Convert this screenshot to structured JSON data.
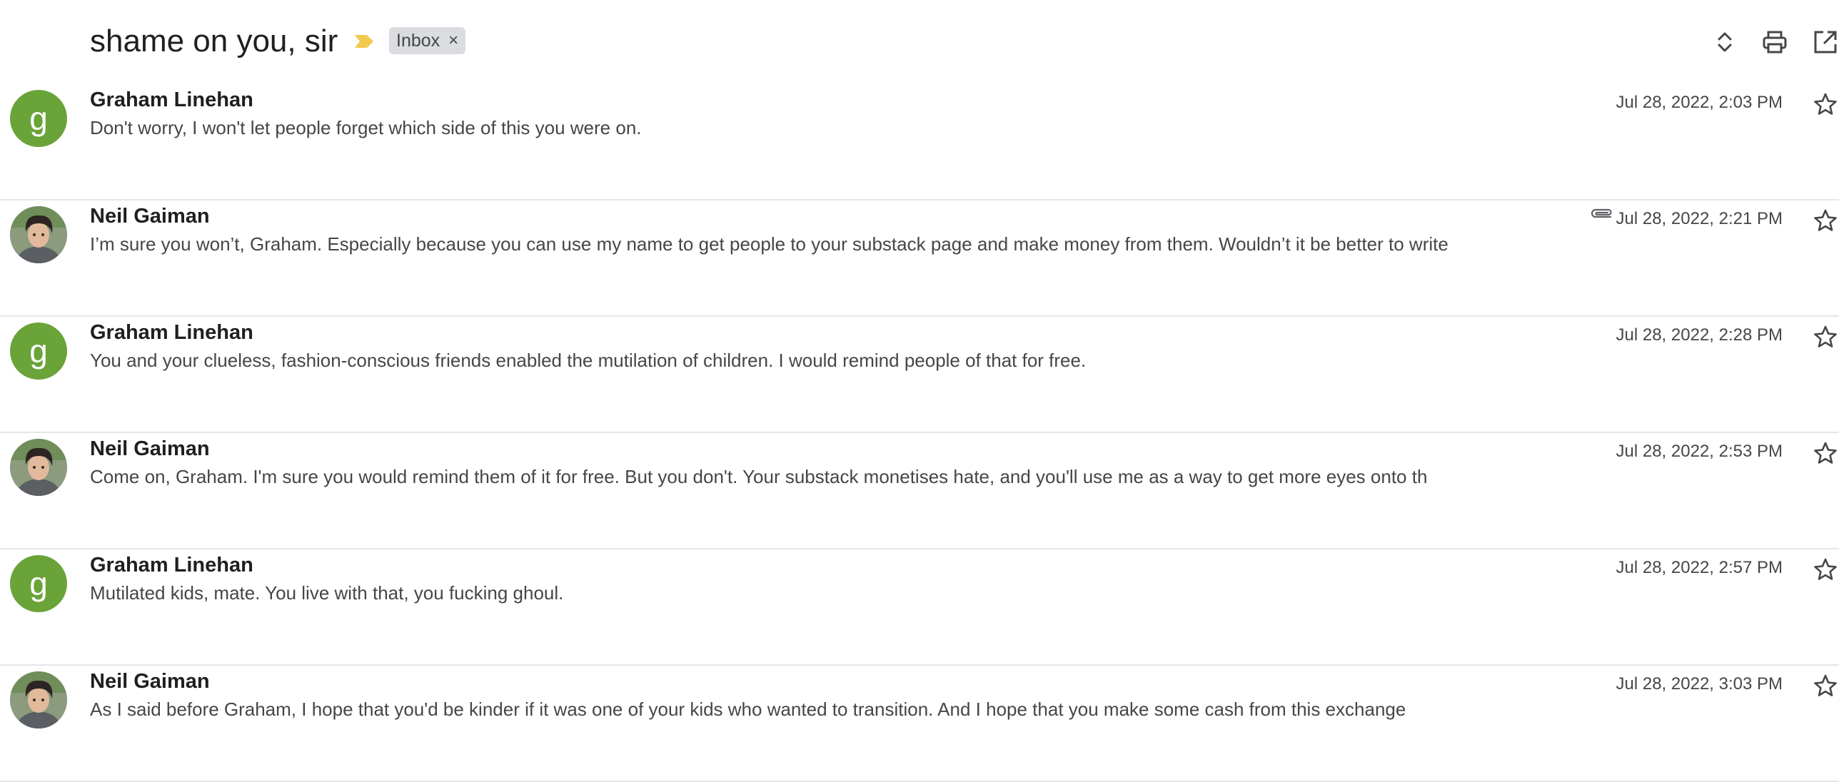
{
  "header": {
    "subject": "shame on you, sir",
    "label": "Inbox",
    "label_remove": "×",
    "icons": [
      "importance-marker-icon",
      "expand-collapse-icon",
      "print-icon",
      "open-in-new-window-icon"
    ]
  },
  "messages": [
    {
      "sender": "Graham Linehan",
      "avatar_type": "letter",
      "avatar_letter": "g",
      "snippet": "Don't worry, I won't let people forget which side of this you were on.",
      "date": "Jul 28, 2022, 2:03 PM",
      "has_attachment": false
    },
    {
      "sender": "Neil Gaiman",
      "avatar_type": "photo",
      "avatar_letter": "",
      "snippet": "I’m sure you won’t, Graham. Especially because you can use my name to get people to your substack page and make money from them. Wouldn’t it be better to write",
      "date": "Jul 28, 2022, 2:21 PM",
      "has_attachment": true
    },
    {
      "sender": "Graham Linehan",
      "avatar_type": "letter",
      "avatar_letter": "g",
      "snippet": "You and your clueless, fashion-conscious friends enabled the mutilation of children. I would remind people of that for free.",
      "date": "Jul 28, 2022, 2:28 PM",
      "has_attachment": false
    },
    {
      "sender": "Neil Gaiman",
      "avatar_type": "photo",
      "avatar_letter": "",
      "snippet": "Come on, Graham. I'm sure you would remind them of it for free. But you don't. Your substack monetises hate, and you'll use me as a way to get more eyes onto th",
      "date": "Jul 28, 2022, 2:53 PM",
      "has_attachment": false
    },
    {
      "sender": "Graham Linehan",
      "avatar_type": "letter",
      "avatar_letter": "g",
      "snippet": "Mutilated kids, mate. You live with that, you fucking ghoul.",
      "date": "Jul 28, 2022, 2:57 PM",
      "has_attachment": false
    },
    {
      "sender": "Neil Gaiman",
      "avatar_type": "photo",
      "avatar_letter": "",
      "snippet": "As I said before Graham, I hope that you'd be kinder if it was one of your kids who wanted to transition. And I hope that you make some cash from this exchange",
      "date": "Jul 28, 2022, 3:03 PM",
      "has_attachment": false
    }
  ],
  "colors": {
    "avatar_letter_bg": "#6aa338",
    "importance": "#f2c94c",
    "label_chip_bg": "#dadce0",
    "divider": "#e6e6e6"
  }
}
